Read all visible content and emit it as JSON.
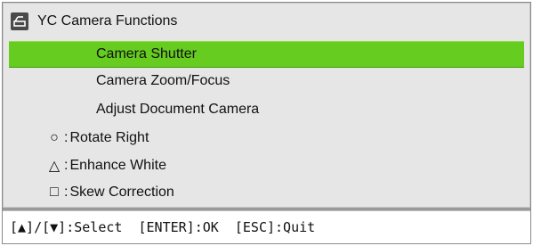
{
  "menu": {
    "title": "YC Camera Functions",
    "title_icon": "camera-document-icon",
    "items": [
      {
        "label": "Camera Shutter",
        "selected": true
      },
      {
        "label": "Camera Zoom/Focus",
        "selected": false
      },
      {
        "label": "Adjust Document Camera",
        "selected": false
      }
    ],
    "shortcuts": [
      {
        "symbol": "○",
        "symbol_name": "circle-icon",
        "label": "Rotate Right"
      },
      {
        "symbol": "△",
        "symbol_name": "triangle-icon",
        "label": "Enhance White"
      },
      {
        "symbol": "□",
        "symbol_name": "square-icon",
        "label": "Skew Correction"
      }
    ],
    "colors": {
      "selected_bg": "#66cc1f",
      "panel_bg": "#e6e6e6"
    }
  },
  "footer": {
    "hint_text": "[▲]/[▼]:Select  [ENTER]:OK  [ESC]:Quit"
  }
}
